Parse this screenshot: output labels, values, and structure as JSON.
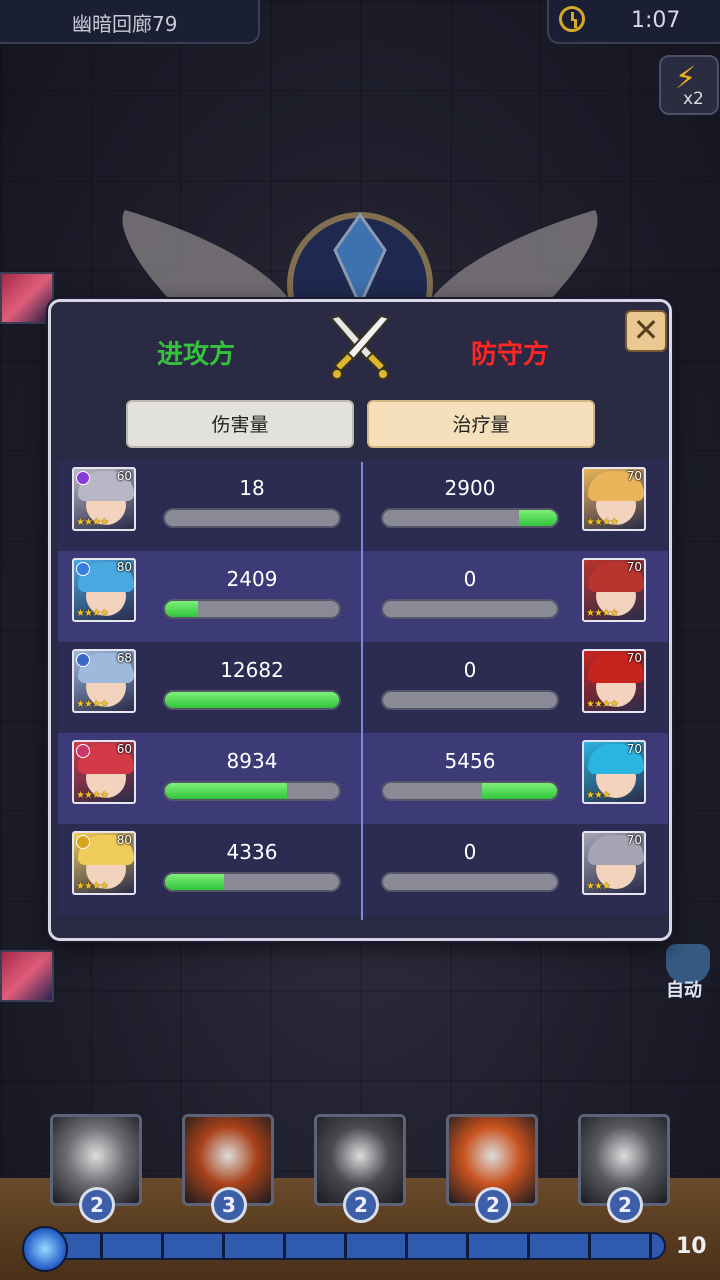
{
  "header": {
    "stage_name": "幽暗回廊79",
    "timer": "1:07",
    "speed_label": "x2"
  },
  "auto_label": "自动",
  "dialog": {
    "attacker_title": "进攻方",
    "defender_title": "防守方",
    "close_symbol": "✕",
    "tabs": [
      "伤害量",
      "治疗量"
    ],
    "selected_tab": "治疗量"
  },
  "attackers": [
    {
      "level": "60",
      "stars": "★★★★",
      "value": "18",
      "fill": 0.0,
      "hair": "#b9b6c6",
      "elem": "#8a3cd8"
    },
    {
      "level": "80",
      "stars": "★★★★",
      "value": "2409",
      "fill": 0.19,
      "hair": "#4aa8e0",
      "elem": "#3a7ce0"
    },
    {
      "level": "68",
      "stars": "★★★★",
      "value": "12682",
      "fill": 1.0,
      "hair": "#9fb9dd",
      "elem": "#3a6ac8"
    },
    {
      "level": "60",
      "stars": "★★★★",
      "value": "8934",
      "fill": 0.7,
      "hair": "#d23a48",
      "elem": "#c8366a"
    },
    {
      "level": "80",
      "stars": "★★★★",
      "value": "4336",
      "fill": 0.34,
      "hair": "#f0cc5a",
      "elem": "#d8a41c"
    }
  ],
  "defenders": [
    {
      "level": "70",
      "stars": "★★★★",
      "value": "2900",
      "fill": 0.22,
      "hair": "#e9b45a"
    },
    {
      "level": "70",
      "stars": "★★★★",
      "value": "0",
      "fill": 0.0,
      "hair": "#b8342e"
    },
    {
      "level": "70",
      "stars": "★★★★",
      "value": "0",
      "fill": 0.0,
      "hair": "#c8241e"
    },
    {
      "level": "70",
      "stars": "★★★",
      "value": "5456",
      "fill": 0.43,
      "hair": "#2ab4e0"
    },
    {
      "level": "70",
      "stars": "★★★",
      "value": "0",
      "fill": 0.0,
      "hair": "#a6a4b4"
    }
  ],
  "skills": [
    {
      "cost": "2",
      "color": "#6e6e74"
    },
    {
      "cost": "3",
      "color": "#a8421a"
    },
    {
      "cost": "2",
      "color": "#4a4a50"
    },
    {
      "cost": "2",
      "color": "#c8521e"
    },
    {
      "cost": "2",
      "color": "#5a5a62"
    }
  ],
  "energy_max": "10"
}
